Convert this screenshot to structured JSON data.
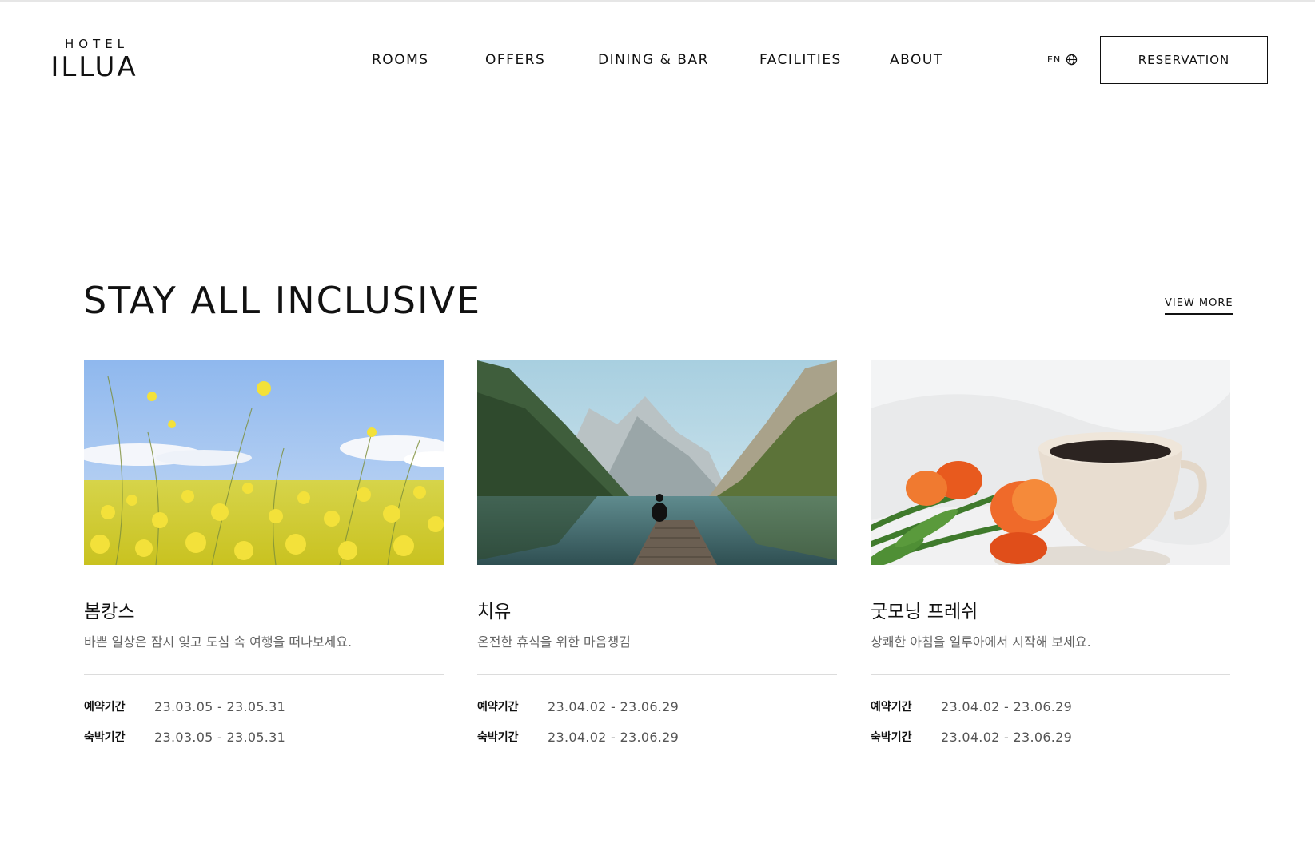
{
  "header": {
    "logo_top": "HOTEL",
    "logo_main": "ILLUA",
    "nav": [
      "ROOMS",
      "OFFERS",
      "DINING & BAR",
      "FACILITIES",
      "ABOUT"
    ],
    "lang": "EN",
    "reservation_label": "RESERVATION"
  },
  "section": {
    "title": "STAY ALL INCLUSIVE",
    "view_more": "VIEW MORE"
  },
  "cards": [
    {
      "title": "봄캉스",
      "description": "바쁜 일상은 잠시 잊고 도심 속 여행을 떠나보세요.",
      "booking_label": "예약기간",
      "booking_period": "23.03.05 - 23.05.31",
      "stay_label": "숙박기간",
      "stay_period": "23.03.05 - 23.05.31",
      "image": "yellow-flower-field"
    },
    {
      "title": "치유",
      "description": "온전한 휴식을 위한 마음챙김",
      "booking_label": "예약기간",
      "booking_period": "23.04.02 - 23.06.29",
      "stay_label": "숙박기간",
      "stay_period": "23.04.02 - 23.06.29",
      "image": "mountain-lake-dock"
    },
    {
      "title": "굿모닝 프레쉬",
      "description": "상쾌한 아침을 일루아에서 시작해 보세요.",
      "booking_label": "예약기간",
      "booking_period": "23.04.02 - 23.06.29",
      "stay_label": "숙박기간",
      "stay_period": "23.04.02 - 23.06.29",
      "image": "tulips-and-coffee-cup"
    }
  ]
}
